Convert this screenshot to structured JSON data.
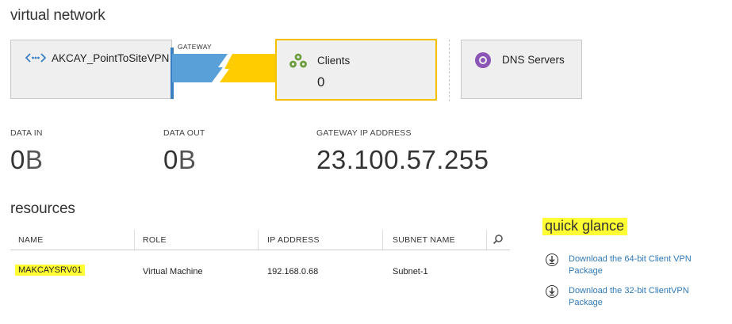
{
  "page": {
    "title": "virtual network"
  },
  "diagram": {
    "vnet_name": "AKCAY_PointToSiteVPN",
    "gateway_label": "GATEWAY",
    "clients": {
      "label": "Clients",
      "count": "0"
    },
    "dns": {
      "label": "DNS Servers"
    },
    "colors": {
      "gateway_blue": "#5aa0d8",
      "gateway_yellow": "#ffcc00",
      "selected_border": "#f2c200"
    }
  },
  "metrics": [
    {
      "label": "DATA IN",
      "value": "0",
      "unit": "B"
    },
    {
      "label": "DATA OUT",
      "value": "0",
      "unit": "B"
    },
    {
      "label": "GATEWAY IP ADDRESS",
      "value": "23.100.57.255"
    }
  ],
  "resources": {
    "title": "resources",
    "columns": [
      "NAME",
      "ROLE",
      "IP ADDRESS",
      "SUBNET NAME"
    ],
    "rows": [
      {
        "name": "MAKCAYSRV01",
        "role": "Virtual Machine",
        "ip": "192.168.0.68",
        "subnet": "Subnet-1"
      }
    ]
  },
  "quick_glance": {
    "title": "quick glance",
    "links": [
      {
        "line1": "Download the 64-bit Client VPN",
        "line2": "Package",
        "icon": "download-icon"
      },
      {
        "line1": "Download the 32-bit ClientVPN",
        "line2": "Package",
        "icon": "download-icon"
      }
    ]
  }
}
